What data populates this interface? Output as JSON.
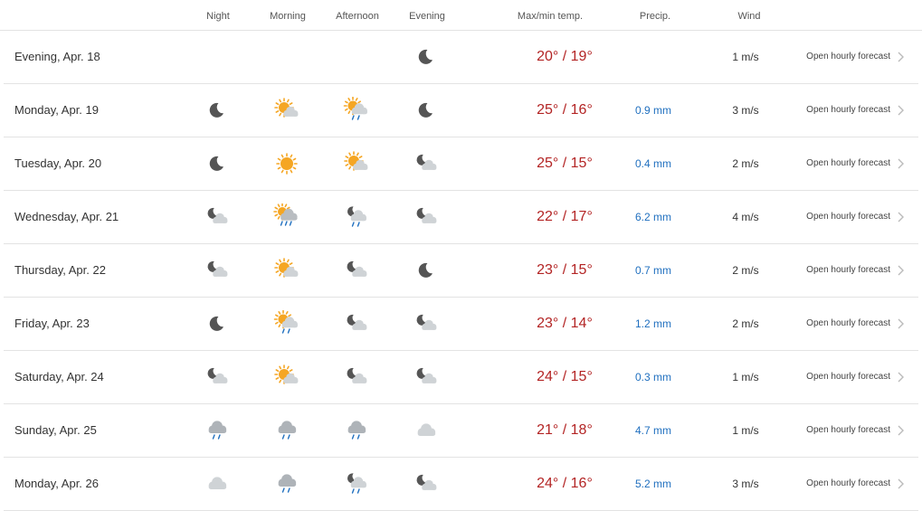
{
  "header": {
    "night": "Night",
    "morning": "Morning",
    "afternoon": "Afternoon",
    "evening": "Evening",
    "temp": "Max/min temp.",
    "precip": "Precip.",
    "wind": "Wind"
  },
  "rows": [
    {
      "day": "Evening, Apr. 18",
      "night": "",
      "morning": "",
      "afternoon": "",
      "evening": "moon-icon",
      "temp": "20° / 19°",
      "precip": "",
      "wind": "1 m/s",
      "link": "Open hourly forecast"
    },
    {
      "day": "Monday, Apr. 19",
      "night": "moon-icon",
      "morning": "sun-cloud-icon",
      "afternoon": "sun-cloud-rain-icon",
      "evening": "moon-icon",
      "temp": "25° / 16°",
      "precip": "0.9 mm",
      "wind": "3 m/s",
      "link": "Open hourly forecast"
    },
    {
      "day": "Tuesday, Apr. 20",
      "night": "moon-icon",
      "morning": "sun-icon",
      "afternoon": "sun-cloud-icon",
      "evening": "moon-cloud-icon",
      "temp": "25° / 15°",
      "precip": "0.4 mm",
      "wind": "2 m/s",
      "link": "Open hourly forecast"
    },
    {
      "day": "Wednesday, Apr. 21",
      "night": "moon-cloud-icon",
      "morning": "sun-cloud-heavy-rain-icon",
      "afternoon": "moon-cloud-rain-icon",
      "evening": "moon-cloud-icon",
      "temp": "22° / 17°",
      "precip": "6.2 mm",
      "wind": "4 m/s",
      "link": "Open hourly forecast"
    },
    {
      "day": "Thursday, Apr. 22",
      "night": "moon-cloud-icon",
      "morning": "sun-cloud-icon",
      "afternoon": "moon-cloud-icon",
      "evening": "moon-icon",
      "temp": "23° / 15°",
      "precip": "0.7 mm",
      "wind": "2 m/s",
      "link": "Open hourly forecast"
    },
    {
      "day": "Friday, Apr. 23",
      "night": "moon-icon",
      "morning": "sun-cloud-rain-icon",
      "afternoon": "moon-cloud-icon",
      "evening": "moon-cloud-icon",
      "temp": "23° / 14°",
      "precip": "1.2 mm",
      "wind": "2 m/s",
      "link": "Open hourly forecast"
    },
    {
      "day": "Saturday, Apr. 24",
      "night": "moon-cloud-icon",
      "morning": "sun-cloud-icon",
      "afternoon": "moon-cloud-icon",
      "evening": "moon-cloud-icon",
      "temp": "24° / 15°",
      "precip": "0.3 mm",
      "wind": "1 m/s",
      "link": "Open hourly forecast"
    },
    {
      "day": "Sunday, Apr. 25",
      "night": "cloud-rain-icon",
      "morning": "cloud-rain-icon",
      "afternoon": "cloud-rain-icon",
      "evening": "cloud-icon",
      "temp": "21° / 18°",
      "precip": "4.7 mm",
      "wind": "1 m/s",
      "link": "Open hourly forecast"
    },
    {
      "day": "Monday, Apr. 26",
      "night": "cloud-icon",
      "morning": "cloud-rain-icon",
      "afternoon": "moon-cloud-rain-icon",
      "evening": "moon-cloud-icon",
      "temp": "24° / 16°",
      "precip": "5.2 mm",
      "wind": "3 m/s",
      "link": "Open hourly forecast"
    }
  ],
  "colors": {
    "temp": "#b32424",
    "precip": "#1f6fbf",
    "sun": "#f5a623",
    "moon": "#555555",
    "cloud": "#cfd3d6",
    "rain": "#1f6fbf",
    "divider": "#e3e3e3"
  }
}
